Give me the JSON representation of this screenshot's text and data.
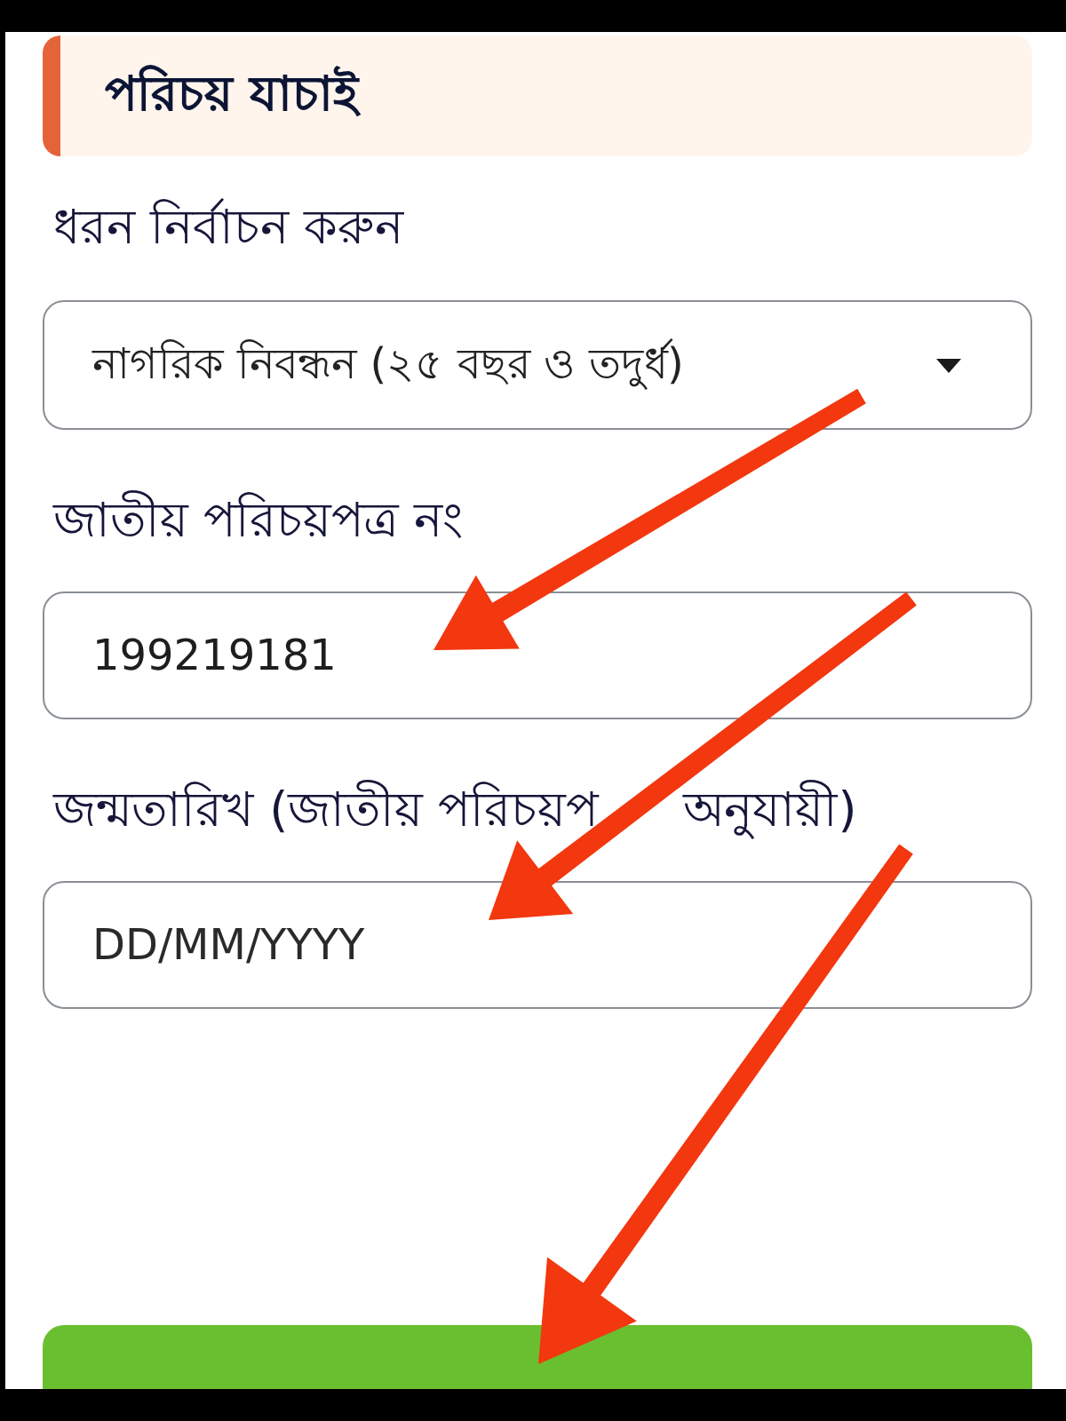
{
  "section": {
    "title": "পরিচয় যাচাই"
  },
  "fields": [
    {
      "kind": "select",
      "label_parts": [
        "ধরন নির্বাচন করুন"
      ],
      "value": "নাগরিক নিবন্ধন (২৫ বছর ও তদুর্ধ)"
    },
    {
      "kind": "text",
      "label_parts": [
        "জাতীয় পরিচয়পত্র নং"
      ],
      "value": "199219181"
    },
    {
      "kind": "text",
      "label_parts": [
        "জন্মতারিখ (জাতীয় পরিচয়প",
        "অনুযায়ী)"
      ],
      "placeholder": "DD/MM/YYYY"
    }
  ]
}
